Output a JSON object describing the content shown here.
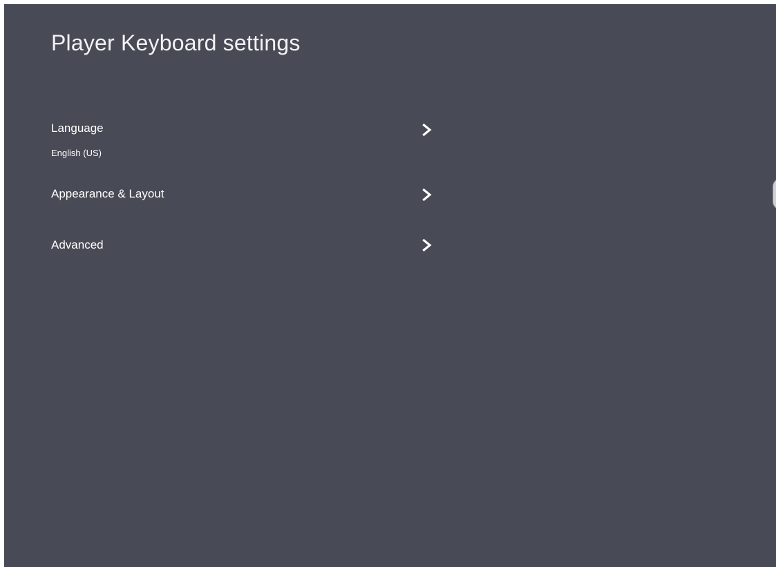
{
  "header": {
    "title": "Player Keyboard settings"
  },
  "settings": {
    "items": [
      {
        "label": "Language",
        "value": "English (US)",
        "icon": "chevron-right-icon"
      },
      {
        "label": "Appearance & Layout",
        "icon": "chevron-right-icon"
      },
      {
        "label": "Advanced",
        "icon": "chevron-right-icon"
      }
    ]
  },
  "colors": {
    "background": "#484a55",
    "text": "#ffffff"
  }
}
